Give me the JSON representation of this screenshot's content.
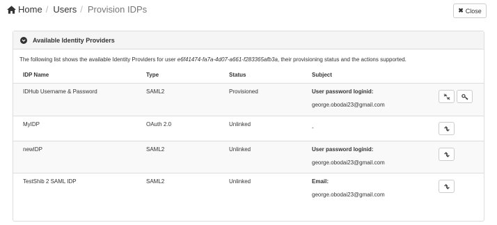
{
  "breadcrumb": {
    "home": "Home",
    "users": "Users",
    "current": "Provision IDPs"
  },
  "close_button": {
    "label": "Close"
  },
  "panel": {
    "title": "Available Identity Providers",
    "intro_prefix": "The following list shows the available Identity Providers for user ",
    "user_id": "e6f41474-fa7a-4d07-a661-f283365afb3a",
    "intro_suffix": ", their provisioning status and the actions supported."
  },
  "table": {
    "headers": {
      "name": "IDP Name",
      "type": "Type",
      "status": "Status",
      "subject": "Subject"
    },
    "rows": [
      {
        "name": "IDHub Username & Password",
        "type": "SAML2",
        "status": "Provisioned",
        "subject_label": "User password loginid:",
        "subject_value": "george.obodai23@gmail.com",
        "actions": [
          "unlink-icon",
          "key-icon"
        ]
      },
      {
        "name": "MyIDP",
        "type": "OAuth 2.0",
        "status": "Unlinked",
        "subject_label": "",
        "subject_value": "-",
        "actions": [
          "link-icon"
        ]
      },
      {
        "name": "newIDP",
        "type": "SAML2",
        "status": "Unlinked",
        "subject_label": "User password loginid:",
        "subject_value": "george.obodai23@gmail.com",
        "actions": [
          "link-icon"
        ]
      },
      {
        "name": "TestShib 2 SAML IDP",
        "type": "SAML2",
        "status": "Unlinked",
        "subject_label": "Email:",
        "subject_value": "george.obodai23@gmail.com",
        "actions": [
          "link-icon"
        ]
      }
    ]
  }
}
